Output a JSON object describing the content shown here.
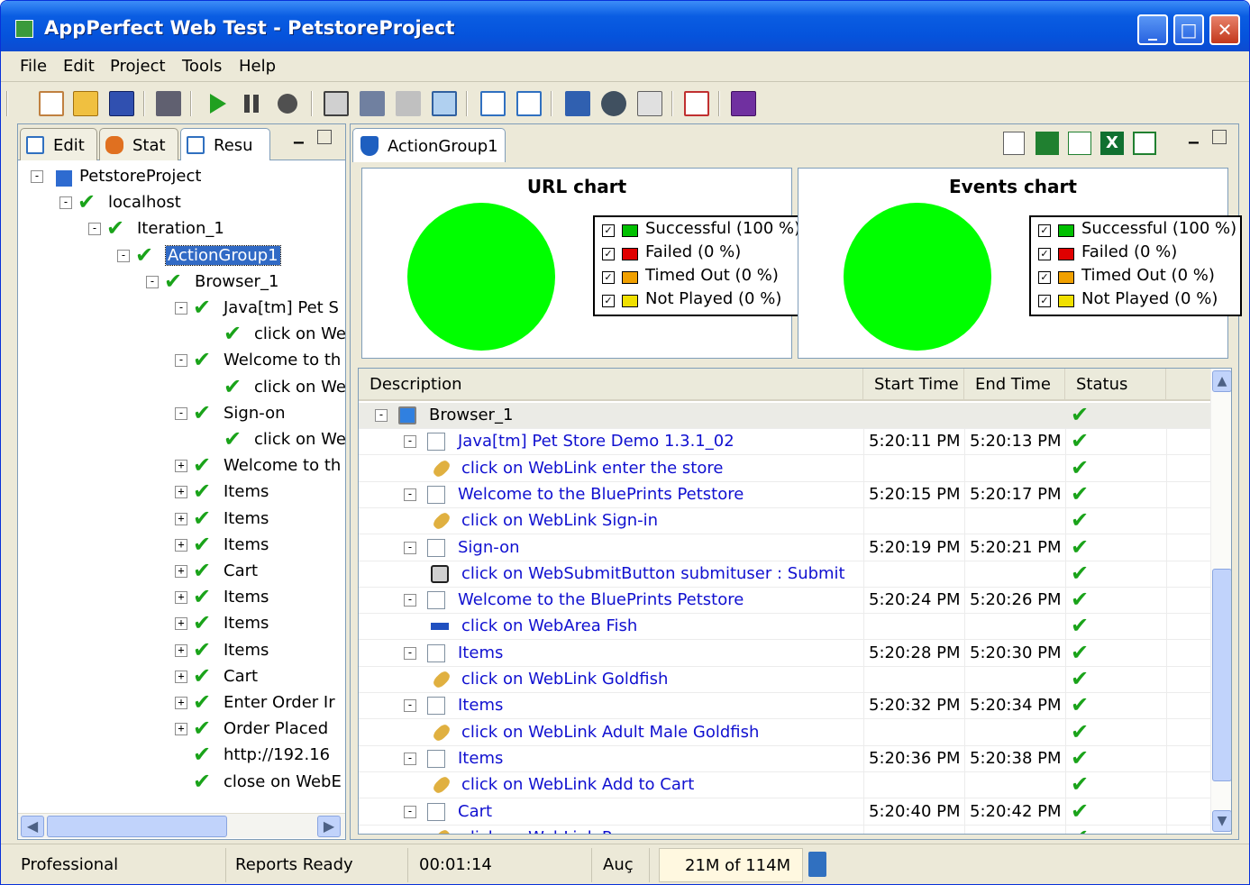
{
  "window": {
    "title": "AppPerfect Web Test - PetstoreProject"
  },
  "menu": {
    "items": [
      "File",
      "Edit",
      "Project",
      "Tools",
      "Help"
    ]
  },
  "toolbar": {
    "icons": [
      "new-project-icon",
      "open-folder-icon",
      "save-icon",
      "camera-icon",
      "play-icon",
      "pause-icon",
      "stop-icon",
      "record-icon",
      "users-icon",
      "script-icon",
      "replay-icon",
      "edit-icon",
      "check-icon",
      "monitor-icon",
      "bug-icon",
      "export-icon",
      "report-icon",
      "help-book-icon"
    ]
  },
  "left_tabs": [
    {
      "label": "Edit",
      "icon": "edit-icon"
    },
    {
      "label": "Stat",
      "icon": "stat-icon"
    },
    {
      "label": "Resu",
      "icon": "result-icon"
    }
  ],
  "tree": [
    {
      "label": "PetstoreProject",
      "expander": "−",
      "icon": "project-icon"
    },
    {
      "label": "localhost",
      "expander": "−"
    },
    {
      "label": "Iteration_1",
      "expander": "−"
    },
    {
      "label": "ActionGroup1",
      "expander": "−",
      "selected": true
    },
    {
      "label": "Browser_1",
      "expander": "−"
    },
    {
      "label": "Java[tm] Pet S",
      "expander": "−"
    },
    {
      "label": "click on We",
      "expander": ""
    },
    {
      "label": "Welcome to th",
      "expander": "−"
    },
    {
      "label": "click on We",
      "expander": ""
    },
    {
      "label": "Sign-on",
      "expander": "−"
    },
    {
      "label": "click on We",
      "expander": ""
    },
    {
      "label": "Welcome to th",
      "expander": "+"
    },
    {
      "label": "Items",
      "expander": "+"
    },
    {
      "label": "Items",
      "expander": "+"
    },
    {
      "label": "Items",
      "expander": "+"
    },
    {
      "label": "Cart",
      "expander": "+"
    },
    {
      "label": "Items",
      "expander": "+"
    },
    {
      "label": "Items",
      "expander": "+"
    },
    {
      "label": "Items",
      "expander": "+"
    },
    {
      "label": "Cart",
      "expander": "+"
    },
    {
      "label": "Enter Order Ir",
      "expander": "+"
    },
    {
      "label": "Order Placed",
      "expander": "+"
    },
    {
      "label": "http://192.16",
      "expander": ""
    },
    {
      "label": "close on WebE",
      "expander": ""
    }
  ],
  "right_tab": {
    "label": "ActionGroup1"
  },
  "report_icons": [
    "text-report-icon",
    "export-report-icon",
    "chart-report-icon",
    "excel-icon",
    "html-report-icon"
  ],
  "charts": [
    {
      "title": "URL chart",
      "legend": [
        "Successful (100 %)",
        "Failed (0 %)",
        "Timed Out (0 %)",
        "Not Played (0 %)"
      ]
    },
    {
      "title": "Events chart",
      "legend": [
        "Successful (100 %)",
        "Failed (0 %)",
        "Timed Out (0 %)",
        "Not Played (0 %)"
      ]
    }
  ],
  "legend_colors": [
    "#00c000",
    "#e00000",
    "#f0a000",
    "#f0e000"
  ],
  "pie_color": "#00ff00",
  "chart_data": [
    {
      "type": "pie",
      "title": "URL chart",
      "categories": [
        "Successful",
        "Failed",
        "Timed Out",
        "Not Played"
      ],
      "values": [
        100,
        0,
        0,
        0
      ]
    },
    {
      "type": "pie",
      "title": "Events chart",
      "categories": [
        "Successful",
        "Failed",
        "Timed Out",
        "Not Played"
      ],
      "values": [
        100,
        0,
        0,
        0
      ]
    }
  ],
  "table": {
    "headers": [
      "Description",
      "Start Time",
      "End Time",
      "Status"
    ],
    "rows": [
      {
        "level": 0,
        "desc": "Browser_1",
        "start": "",
        "end": "",
        "icon": "browser-icon",
        "expander": "−"
      },
      {
        "level": 1,
        "desc": "Java[tm] Pet Store Demo 1.3.1_02",
        "start": "5:20:11 PM",
        "end": "5:20:13 PM",
        "icon": "page-icon",
        "expander": "−"
      },
      {
        "level": 2,
        "desc": "click on WebLink enter the store",
        "start": "",
        "end": "",
        "icon": "link-icon",
        "expander": ""
      },
      {
        "level": 1,
        "desc": "Welcome to the BluePrints Petstore",
        "start": "5:20:15 PM",
        "end": "5:20:17 PM",
        "icon": "page-icon",
        "expander": "−"
      },
      {
        "level": 2,
        "desc": "click on WebLink Sign-in",
        "start": "",
        "end": "",
        "icon": "link-icon",
        "expander": ""
      },
      {
        "level": 1,
        "desc": "Sign-on",
        "start": "5:20:19 PM",
        "end": "5:20:21 PM",
        "icon": "page-icon",
        "expander": "−"
      },
      {
        "level": 2,
        "desc": "click on WebSubmitButton submituser : Submit",
        "start": "",
        "end": "",
        "icon": "button-icon",
        "expander": ""
      },
      {
        "level": 1,
        "desc": "Welcome to the BluePrints Petstore",
        "start": "5:20:24 PM",
        "end": "5:20:26 PM",
        "icon": "page-icon",
        "expander": "−"
      },
      {
        "level": 2,
        "desc": "click on WebArea Fish",
        "start": "",
        "end": "",
        "icon": "area-icon",
        "expander": ""
      },
      {
        "level": 1,
        "desc": "Items",
        "start": "5:20:28 PM",
        "end": "5:20:30 PM",
        "icon": "page-icon",
        "expander": "−"
      },
      {
        "level": 2,
        "desc": "click on WebLink Goldfish",
        "start": "",
        "end": "",
        "icon": "link-icon",
        "expander": ""
      },
      {
        "level": 1,
        "desc": "Items",
        "start": "5:20:32 PM",
        "end": "5:20:34 PM",
        "icon": "page-icon",
        "expander": "−"
      },
      {
        "level": 2,
        "desc": "click on WebLink Adult Male Goldfish",
        "start": "",
        "end": "",
        "icon": "link-icon",
        "expander": ""
      },
      {
        "level": 1,
        "desc": "Items",
        "start": "5:20:36 PM",
        "end": "5:20:38 PM",
        "icon": "page-icon",
        "expander": "−"
      },
      {
        "level": 2,
        "desc": "click on WebLink Add to Cart",
        "start": "",
        "end": "",
        "icon": "link-icon",
        "expander": ""
      },
      {
        "level": 1,
        "desc": "Cart",
        "start": "5:20:40 PM",
        "end": "5:20:42 PM",
        "icon": "page-icon",
        "expander": "−"
      },
      {
        "level": 2,
        "desc": "click on WebLink R",
        "start": "",
        "end": "",
        "icon": "link-icon",
        "expander": ""
      }
    ]
  },
  "status_bar": {
    "edition": "Professional",
    "report_state": "Reports Ready",
    "elapsed": "00:01:14",
    "auc": "Auç",
    "memory": "21M of 114M"
  }
}
